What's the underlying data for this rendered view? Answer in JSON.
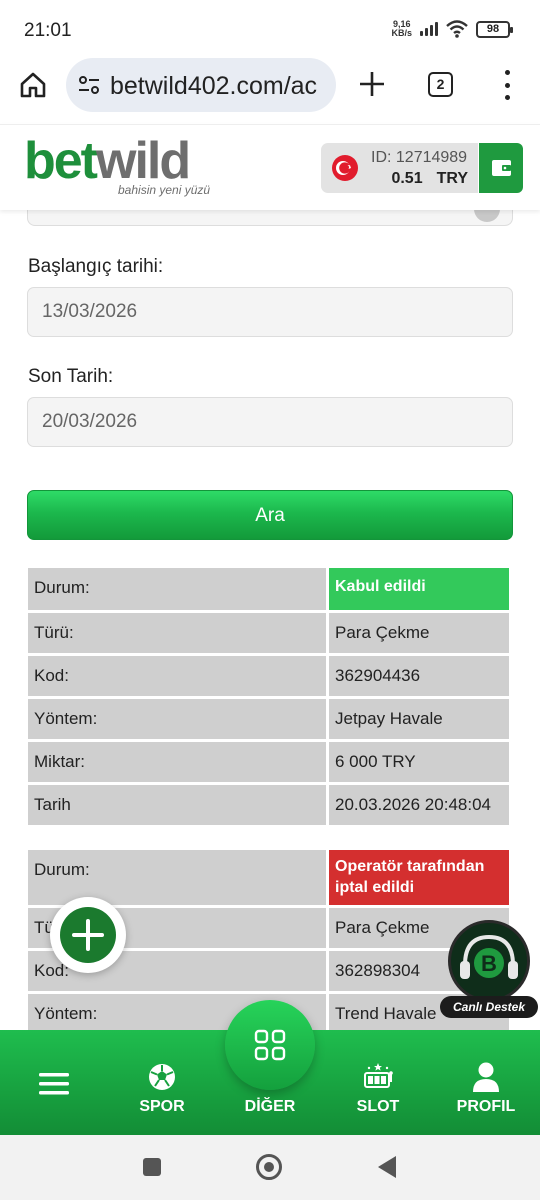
{
  "status_bar": {
    "time": "21:01",
    "net_speed_value": "9,16",
    "net_speed_unit": "KB/s",
    "battery": "98"
  },
  "browser": {
    "url": "betwild402.com/ac",
    "tab_count": "2"
  },
  "site_header": {
    "logo_part1": "bet",
    "logo_part2": "wild",
    "tagline": "bahisin yeni yüzü",
    "account_id": "ID: 12714989",
    "balance": "0.51",
    "currency": "TRY"
  },
  "filters": {
    "start_label": "Başlangıç tarihi:",
    "start_value": "13/03/2026",
    "end_label": "Son Tarih:",
    "end_value": "20/03/2026",
    "search_button": "Ara"
  },
  "records": [
    {
      "status_label": "Durum:",
      "status_value": "Kabul edildi",
      "type_label": "Türü:",
      "type_value": "Para Çekme",
      "code_label": "Kod:",
      "code_value": "362904436",
      "method_label": "Yöntem:",
      "method_value": "Jetpay Havale",
      "amount_label": "Miktar:",
      "amount_value": "6 000 TRY",
      "date_label": "Tarih",
      "date_value": "20.03.2026 20:48:04"
    },
    {
      "status_label": "Durum:",
      "status_value": "Operatör tarafından iptal edildi",
      "type_label": "Tü",
      "type_value": "Para Çekme",
      "code_label": "Kod:",
      "code_value": "362898304",
      "method_label": "Yöntem:",
      "method_value": "Trend Havale"
    }
  ],
  "live_support": {
    "badge_letter": "B",
    "label": "Canlı Destek"
  },
  "bottom_nav": {
    "sport": "SPOR",
    "other": "DİĞER",
    "slot": "SLOT",
    "profile": "PROFIL"
  },
  "colors": {
    "brand_green": "#1e8f3b",
    "accepted": "#33c95b",
    "cancelled": "#d42f2f"
  }
}
